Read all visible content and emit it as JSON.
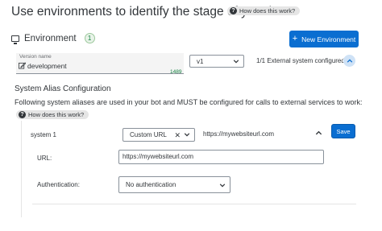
{
  "page": {
    "title": "Use environments to identify the stage of your bot",
    "help_label": "How does this work?"
  },
  "environment": {
    "label": "Environment",
    "count": "1",
    "new_button_label": "New Environment",
    "version_label": "Version name",
    "version_value": "development",
    "char_count": "1489",
    "version_select_value": "v1",
    "external_status": "1/1 External system configured"
  },
  "alias_config": {
    "title": "System Alias Configuration",
    "description": "Following system aliases are used in your bot and MUST be configured for calls to external services to work:",
    "help_label": "How does this work?",
    "system": {
      "name": "system 1",
      "type_value": "Custom URL",
      "url_display": "https://mywebsiteurl.com",
      "save_label": "Save",
      "url_label": "URL:",
      "url_value": "https://mywebsiteurl.com",
      "auth_label": "Authentication:",
      "auth_value": "No authentication"
    }
  },
  "icons": {
    "help": "question-circle-icon",
    "environment": "monitor-icon",
    "add": "plus-icon",
    "edit": "pencil-icon",
    "dropdown": "chevron-down-icon",
    "collapse": "chevron-up-icon",
    "clear": "close-icon"
  },
  "colors": {
    "primary": "#0a6ed1",
    "success": "#107e3e",
    "collapse_bg": "#cfe2f6"
  }
}
